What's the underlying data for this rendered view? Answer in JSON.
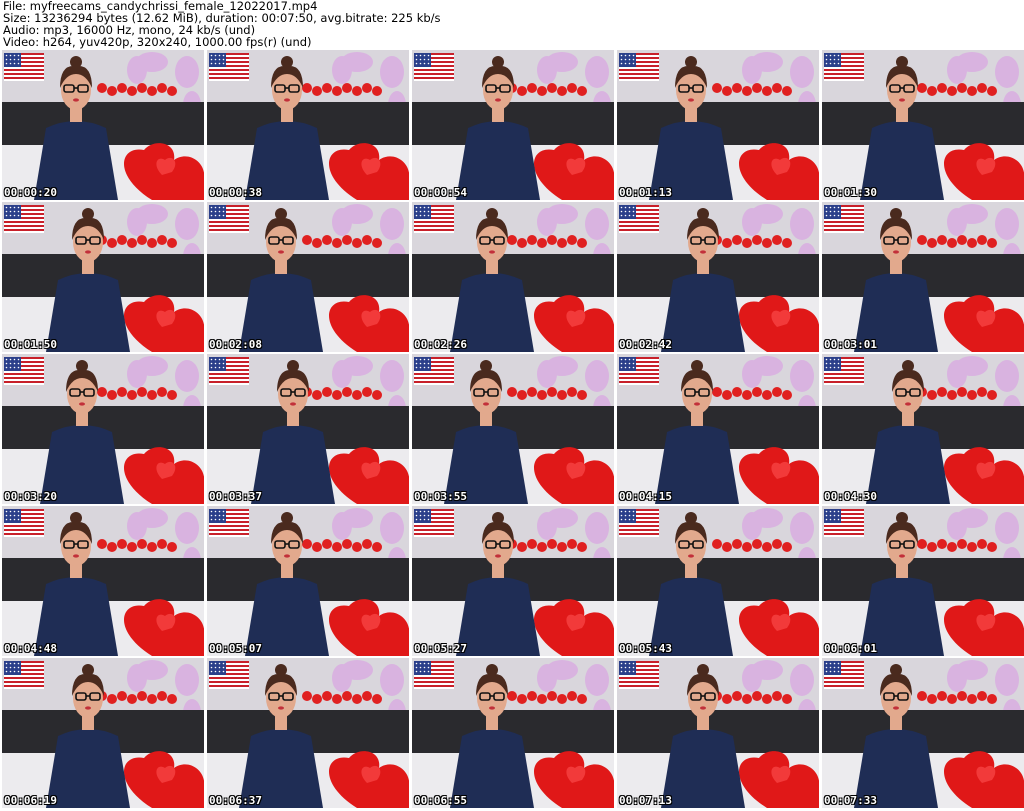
{
  "header": {
    "file_line": "File: myfreecams_candychrissi_female_12022017.mp4",
    "size_line": "Size: 13236294 bytes (12.62 MiB), duration: 00:07:50, avg.bitrate: 225 kb/s",
    "audio_line": "Audio: mp3, 16000 Hz, mono, 24 kb/s (und)",
    "video_line": "Video: h264, yuv420p, 320x240, 1000.00 fps(r) (und)"
  },
  "thumbnails": [
    {
      "timestamp": "00:00:20"
    },
    {
      "timestamp": "00:00:38"
    },
    {
      "timestamp": "00:00:54"
    },
    {
      "timestamp": "00:01:13"
    },
    {
      "timestamp": "00:01:30"
    },
    {
      "timestamp": "00:01:50"
    },
    {
      "timestamp": "00:02:08"
    },
    {
      "timestamp": "00:02:26"
    },
    {
      "timestamp": "00:02:42"
    },
    {
      "timestamp": "00:03:01"
    },
    {
      "timestamp": "00:03:20"
    },
    {
      "timestamp": "00:03:37"
    },
    {
      "timestamp": "00:03:55"
    },
    {
      "timestamp": "00:04:15"
    },
    {
      "timestamp": "00:04:30"
    },
    {
      "timestamp": "00:04:48"
    },
    {
      "timestamp": "00:05:07"
    },
    {
      "timestamp": "00:05:27"
    },
    {
      "timestamp": "00:05:43"
    },
    {
      "timestamp": "00:06:01"
    },
    {
      "timestamp": "00:06:19"
    },
    {
      "timestamp": "00:06:37"
    },
    {
      "timestamp": "00:06:55"
    },
    {
      "timestamp": "00:07:13"
    },
    {
      "timestamp": "00:07:33"
    }
  ],
  "colors": {
    "dress": "#1f2d55",
    "heart": "#e01818",
    "background": "#d9d6dc",
    "couch": "#2a2a2e",
    "flower": "#d9b3e0",
    "skin": "#e2a98d",
    "hair": "#4a2a1e"
  }
}
